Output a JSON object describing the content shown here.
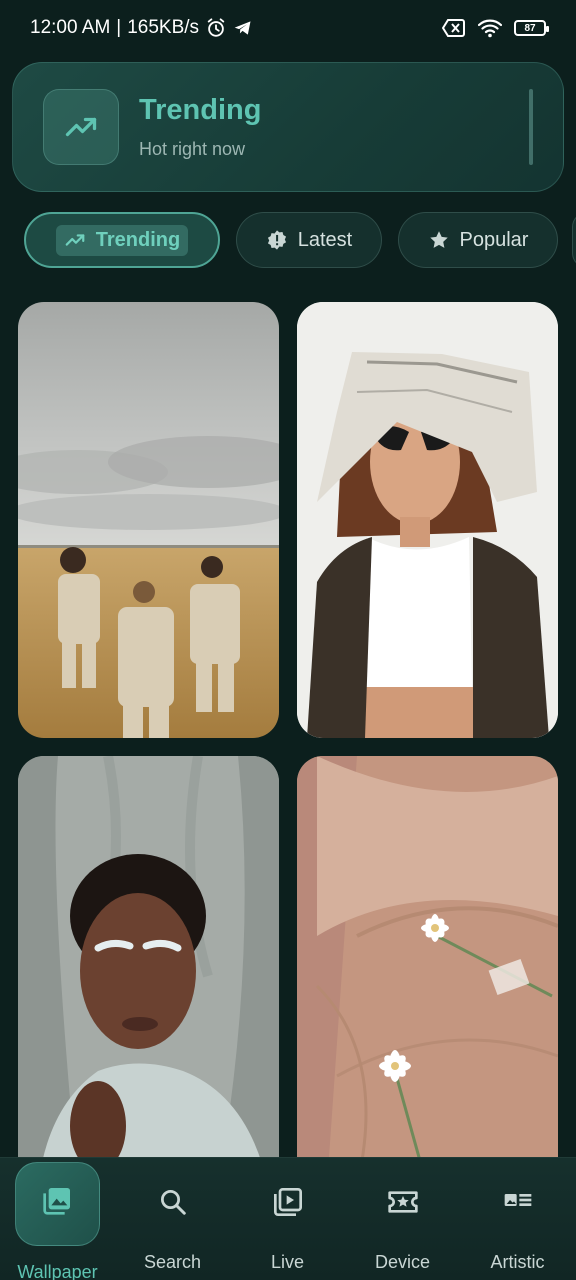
{
  "status_bar": {
    "time": "12:00 AM",
    "separator": "|",
    "speed": "165KB/s",
    "battery": "87"
  },
  "header": {
    "title": "Trending",
    "subtitle": "Hot right now",
    "icon": "trending-up-icon"
  },
  "chips": [
    {
      "label": "Trending",
      "icon": "trending-up-icon",
      "active": true
    },
    {
      "label": "Latest",
      "icon": "new-badge-icon",
      "active": false
    },
    {
      "label": "Popular",
      "icon": "star-icon",
      "active": false
    }
  ],
  "wallpapers": [
    {
      "subject": "three people in suits standing in wheat field"
    },
    {
      "subject": "woman with newspaper on head and sunglasses"
    },
    {
      "subject": "portrait of woman with silver eyebrows"
    },
    {
      "subject": "white daisies on beige linen fabric"
    }
  ],
  "bottom_nav": [
    {
      "label": "Wallpaper",
      "icon": "image-icon",
      "active": true
    },
    {
      "label": "Search",
      "icon": "search-icon",
      "active": false
    },
    {
      "label": "Live",
      "icon": "video-library-icon",
      "active": false
    },
    {
      "label": "Device",
      "icon": "ticket-star-icon",
      "active": false
    },
    {
      "label": "Artistic",
      "icon": "article-icon",
      "active": false
    }
  ],
  "colors": {
    "background": "#0c1f1d",
    "accent": "#5ec4b2",
    "card": "#1e4a44"
  }
}
